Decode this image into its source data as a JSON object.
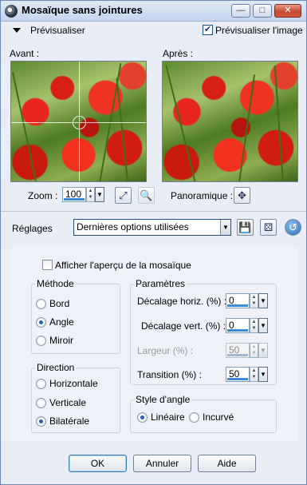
{
  "window": {
    "title": "Mosaïque sans jointures",
    "controls": {
      "minimize": "—",
      "maximize": "□",
      "close": "✕"
    }
  },
  "preview": {
    "toggle_label": "Prévisualiser",
    "preview_image_label": "Prévisualiser l'image",
    "preview_image_checked": true,
    "before_label": "Avant :",
    "after_label": "Après :",
    "zoom_label": "Zoom :",
    "zoom_value": "100",
    "pan_label": "Panoramique :"
  },
  "settings": {
    "label": "Réglages",
    "preset_value": "Dernières options utilisées"
  },
  "options": {
    "show_tile_preview_label": "Afficher l'aperçu de la mosaïque",
    "show_tile_preview_checked": false
  },
  "method": {
    "title": "Méthode",
    "options": [
      "Bord",
      "Angle",
      "Miroir"
    ],
    "selected": "Angle"
  },
  "direction": {
    "title": "Direction",
    "options": [
      "Horizontale",
      "Verticale",
      "Bilatérale"
    ],
    "selected": "Bilatérale"
  },
  "parameters": {
    "title": "Paramètres",
    "horizontal_offset": {
      "label": "Décalage horiz. (%) :",
      "value": "0"
    },
    "vertical_offset": {
      "label": "Décalage vert. (%) :",
      "value": "0"
    },
    "width": {
      "label": "Largeur (%) :",
      "value": "50",
      "disabled": true
    },
    "transition": {
      "label": "Transition (%) :",
      "value": "50"
    }
  },
  "corner_style": {
    "title": "Style d'angle",
    "options": [
      "Linéaire",
      "Incurvé"
    ],
    "selected": "Linéaire"
  },
  "buttons": {
    "ok": "OK",
    "cancel": "Annuler",
    "help": "Aide"
  },
  "colors": {
    "accent": "#3e8ad8",
    "window_bg": "#e9eef6",
    "poppy_red": "#e8261c"
  }
}
